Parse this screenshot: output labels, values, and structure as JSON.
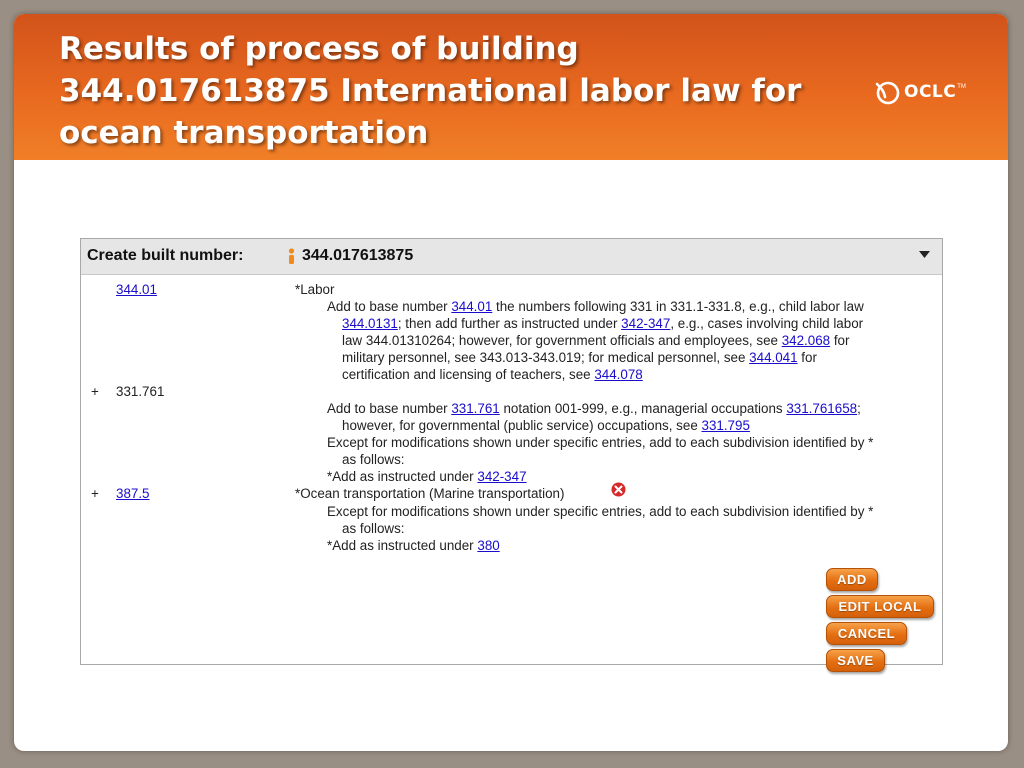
{
  "slide": {
    "title": "Results of process of building 344.017613875 International labor law for ocean transportation",
    "logo_text": "OCLC",
    "logo_tm": "TM"
  },
  "panel": {
    "header_label": "Create built number:",
    "built_number": "344.017613875",
    "icons": {
      "person": "person-icon",
      "collapse": "triangle-down-icon",
      "remove": "remove-circle-icon"
    },
    "rows": {
      "r1_num": "344.01",
      "r1_caption": "*Labor",
      "r1_l1a": "Add to base number ",
      "r1_l1b": "344.01",
      "r1_l1c": " the numbers following 331 in 331.1-331.8, e.g., child labor law",
      "r1_l2a": "344.0131",
      "r1_l2b": "; then add further as instructed under ",
      "r1_l2c": "342-347",
      "r1_l2d": ", e.g., cases involving child labor",
      "r1_l3a": "law 344.01310264; however, for government officials and employees, see ",
      "r1_l3b": "342.068",
      "r1_l3c": " for",
      "r1_l4a": "military personnel, see 343.013-343.019; for medical personnel, see ",
      "r1_l4b": "344.041",
      "r1_l4c": " for",
      "r1_l5a": "certification and licensing of teachers, see ",
      "r1_l5b": "344.078",
      "r2_plus": "+",
      "r2_num": "331.761",
      "r2_l1a": "Add to base number ",
      "r2_l1b": "331.761",
      "r2_l1c": " notation 001-999, e.g., managerial occupations ",
      "r2_l1d": "331.761658",
      "r2_l1e": ";",
      "r2_l2a": "however, for governmental (public service) occupations, see ",
      "r2_l2b": "331.795",
      "r2_l3": "Except for modifications shown under specific entries, add to each subdivision identified by *",
      "r2_l4": "as follows:",
      "r2_l5a": "*Add as instructed under ",
      "r2_l5b": "342-347",
      "r3_plus": "+",
      "r3_num": "387.5",
      "r3_caption": "*Ocean transportation (Marine transportation)",
      "r3_l1": "Except for modifications shown under specific entries, add to each subdivision identified by *",
      "r3_l2": "as follows:",
      "r3_l3a": "*Add as instructed under ",
      "r3_l3b": "380"
    },
    "buttons": {
      "add": "ADD",
      "edit_local": "EDIT LOCAL",
      "cancel": "CANCEL",
      "save": "SAVE"
    }
  },
  "colors": {
    "banner": "#e8691f",
    "button": "#e46f12",
    "link": "#1a0dcc",
    "remove": "#d42a2a"
  }
}
